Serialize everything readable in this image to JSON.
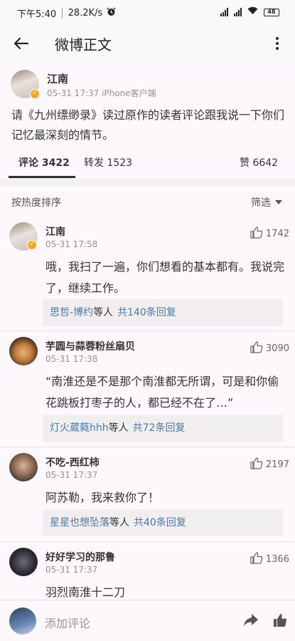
{
  "status_bar": {
    "time": "下午5:40",
    "net_speed": "28.2K/s",
    "battery": "48",
    "icons": [
      "alarm-icon",
      "signal-icon",
      "wifi-icon",
      "battery-icon"
    ]
  },
  "nav": {
    "title": "微博正文",
    "back_icon": "back-arrow-icon",
    "more_icon": "more-vertical-icon"
  },
  "post": {
    "author": "江南",
    "date": "05-31 17:37",
    "source": "iPhone客户端",
    "text": "请《九州缥缈录》读过原作的读者评论跟我说一下你们记忆最深刻的情节。",
    "tabs": [
      {
        "label": "评论 3422",
        "active": true
      },
      {
        "label": "转发 1523",
        "active": false
      },
      {
        "label": "赞 6642",
        "active": false
      }
    ]
  },
  "comments_section": {
    "sort_label": "按热度排序",
    "filter_label": "筛选",
    "items": [
      {
        "author": "江南",
        "time": "05-31 17:58",
        "likes": "1742",
        "text": "哦，我扫了一遍，你们想看的基本都有。我说完了，继续工作。",
        "reply_names": "思哲-博约",
        "reply_etc": "等人",
        "reply_count": "共140条回复"
      },
      {
        "author": "芋圆与蒜蓉粉丝扇贝",
        "time": "05-31 17:38",
        "likes": "3090",
        "text": "“南淮还是不是那个南淮都无所谓，可是和你偷花跳板打枣子的人，都已经不在了…”",
        "reply_names": "灯火葳蕤hhh",
        "reply_etc": "等人",
        "reply_count": "共72条回复"
      },
      {
        "author": "不吃-西红柿",
        "time": "05-31 17:37",
        "likes": "2197",
        "text": "阿苏勒，我来救你了！",
        "reply_names": "星星也想坠落",
        "reply_etc": "等人",
        "reply_count": "共40条回复"
      },
      {
        "author": "好好学习的那鲁",
        "time": "05-31 17:37",
        "likes": "1366",
        "text": "羽烈南淮十二刀"
      }
    ]
  },
  "bottom_bar": {
    "placeholder": "添加评论",
    "share_icon": "share-icon",
    "like_icon": "thumbs-up-icon"
  },
  "colors": {
    "link": "#4b78a8",
    "verified_badge": "#f5a623",
    "meta_text": "#939393"
  }
}
